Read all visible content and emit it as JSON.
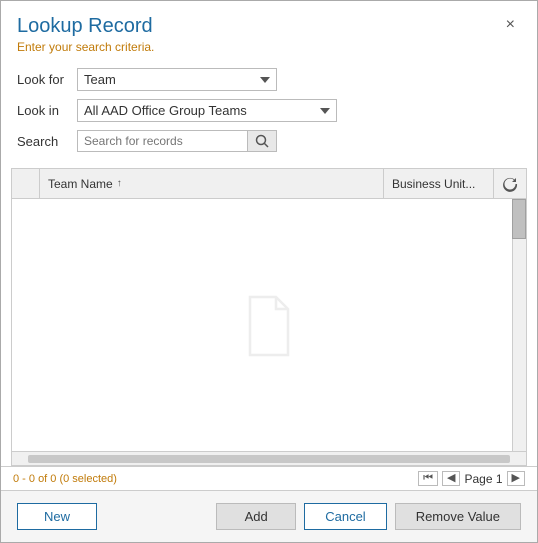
{
  "dialog": {
    "title": "Lookup Record",
    "subtitle": "Enter your search criteria.",
    "close_label": "×"
  },
  "form": {
    "look_for_label": "Look for",
    "look_in_label": "Look in",
    "search_label": "Search",
    "look_for_value": "Team",
    "look_in_value": "All AAD Office Group Teams",
    "search_placeholder": "Search for records",
    "look_for_options": [
      "Team"
    ],
    "look_in_options": [
      "All AAD Office Group Teams"
    ]
  },
  "table": {
    "col_teamname": "Team Name",
    "col_businessunit": "Business Unit...",
    "sort_indicator": "↑",
    "rows": []
  },
  "status": {
    "record_count": "0 - 0 of 0 (0 selected)",
    "page_label": "Page 1"
  },
  "footer": {
    "new_label": "New",
    "add_label": "Add",
    "cancel_label": "Cancel",
    "remove_label": "Remove Value"
  }
}
